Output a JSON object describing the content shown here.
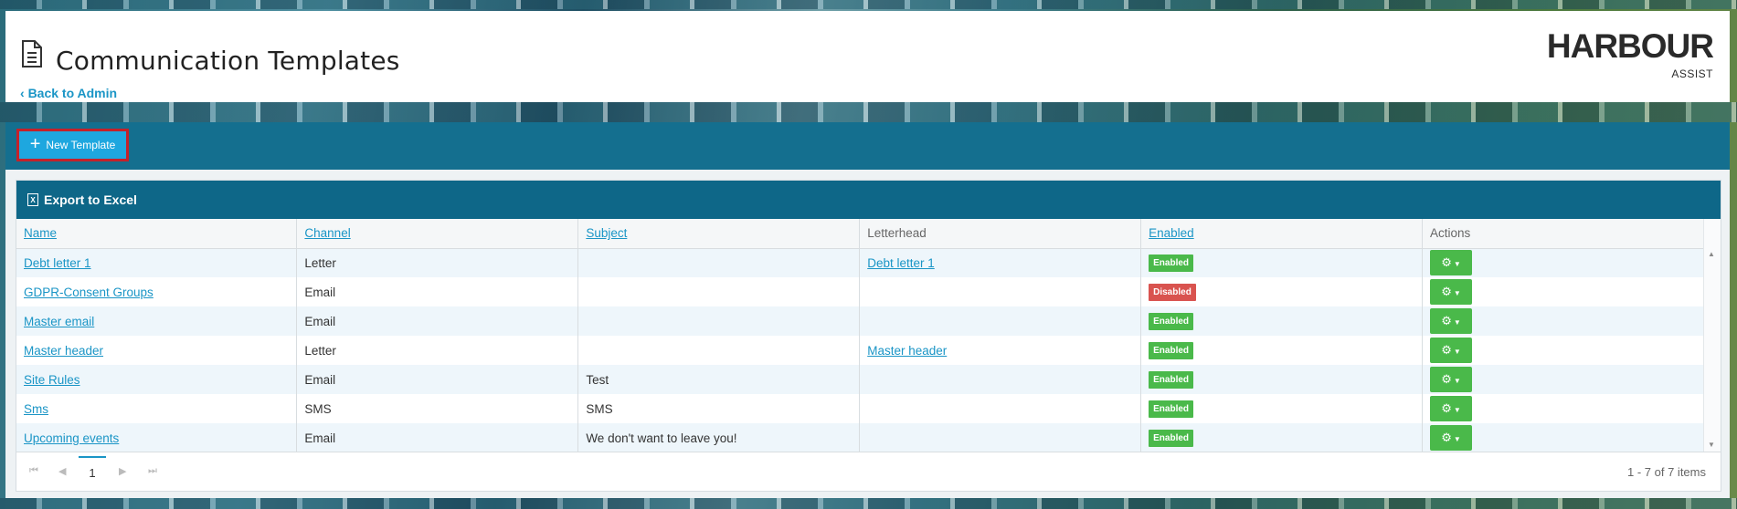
{
  "header": {
    "title": "Communication Templates",
    "back_link": "Back to Admin",
    "logo_main": "HARBOUR",
    "logo_sub": "ASSIST"
  },
  "toolbar": {
    "new_template_label": "New Template"
  },
  "grid": {
    "export_label": "Export to Excel",
    "columns": [
      "Name",
      "Channel",
      "Subject",
      "Letterhead",
      "Enabled",
      "Actions"
    ],
    "rows": [
      {
        "name": "Debt letter 1",
        "channel": "Letter",
        "subject": "",
        "letterhead": "Debt letter 1",
        "enabled": "Enabled"
      },
      {
        "name": "GDPR-Consent Groups",
        "channel": "Email",
        "subject": "",
        "letterhead": "",
        "enabled": "Disabled"
      },
      {
        "name": "Master email",
        "channel": "Email",
        "subject": "",
        "letterhead": "",
        "enabled": "Enabled"
      },
      {
        "name": "Master header",
        "channel": "Letter",
        "subject": "",
        "letterhead": "Master header",
        "enabled": "Enabled"
      },
      {
        "name": "Site Rules",
        "channel": "Email",
        "subject": "Test",
        "letterhead": "",
        "enabled": "Enabled"
      },
      {
        "name": "Sms",
        "channel": "SMS",
        "subject": "SMS",
        "letterhead": "",
        "enabled": "Enabled"
      },
      {
        "name": "Upcoming events",
        "channel": "Email",
        "subject": "We don't want to leave you!",
        "letterhead": "",
        "enabled": "Enabled"
      }
    ],
    "pager": {
      "current_page": "1",
      "info": "1 - 7 of 7 items"
    }
  },
  "colors": {
    "accent": "#1a95c6",
    "toolbar": "#146f8f",
    "enabled": "#4ab94a",
    "disabled": "#d9534f",
    "highlight_border": "#c4212a"
  },
  "icons": [
    "document-icon",
    "chevron-left-icon",
    "plus-icon",
    "excel-icon",
    "gear-icon",
    "caret-down-icon"
  ]
}
